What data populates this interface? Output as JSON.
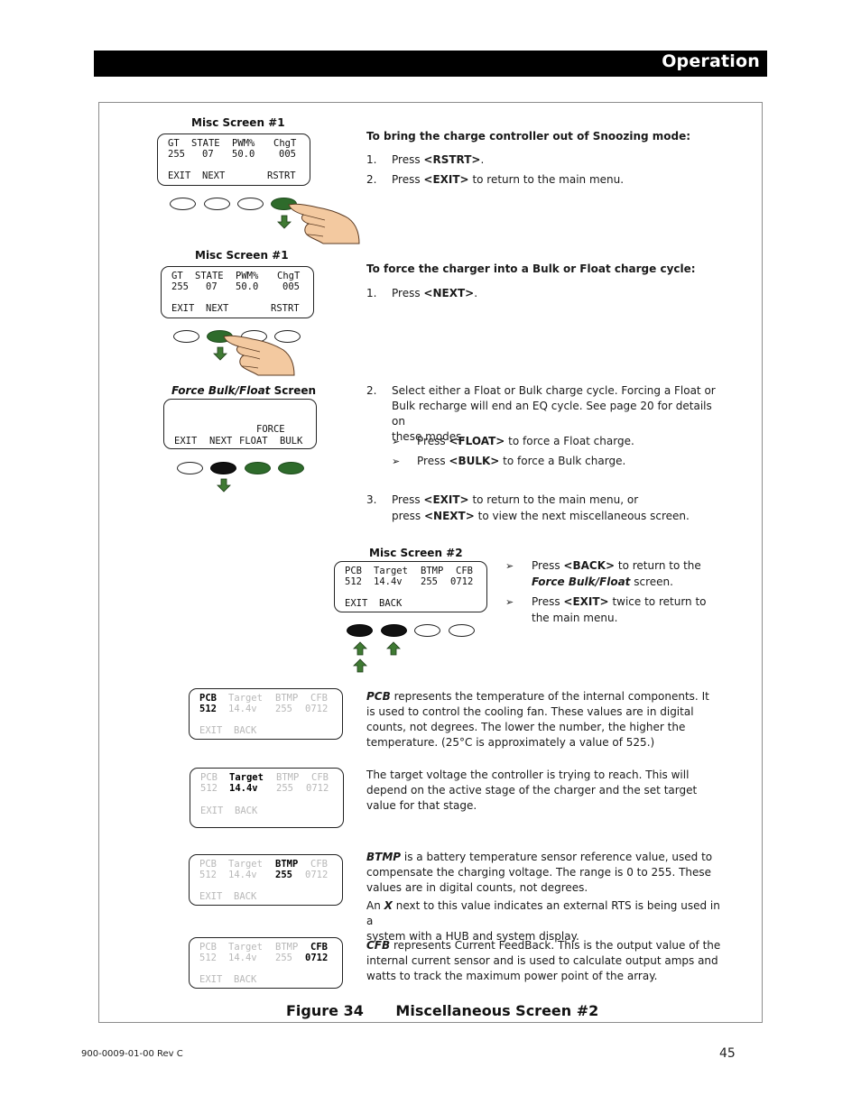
{
  "header": {
    "title": "Operation"
  },
  "screens": {
    "misc1_a": {
      "caption": "Misc Screen #1",
      "headers": [
        "GT",
        "STATE",
        "PWM%",
        "ChgT"
      ],
      "values": [
        "255",
        "07",
        "50.0",
        "005"
      ],
      "softkeys": [
        "EXIT",
        "NEXT",
        "",
        "RSTRT"
      ],
      "buttons": [
        "white",
        "white",
        "white",
        "green"
      ],
      "pressed_button": 4
    },
    "misc1_b": {
      "caption": "Misc Screen #1",
      "headers": [
        "GT",
        "STATE",
        "PWM%",
        "ChgT"
      ],
      "values": [
        "255",
        "07",
        "50.0",
        "005"
      ],
      "softkeys": [
        "EXIT",
        "NEXT",
        "",
        "RSTRT"
      ],
      "buttons": [
        "white",
        "green",
        "white",
        "white"
      ],
      "pressed_button": 2
    },
    "force": {
      "caption_italic": "Force Bulk/Float",
      "caption_rest": " Screen",
      "line1": "FORCE",
      "softkeys": [
        "EXIT",
        "NEXT",
        "FLOAT",
        "BULK"
      ],
      "buttons": [
        "white",
        "black",
        "green",
        "green"
      ]
    },
    "misc2": {
      "caption": "Misc Screen #2",
      "headers": [
        "PCB",
        "Target",
        "BTMP",
        "CFB"
      ],
      "values": [
        "512",
        "14.4v",
        "255",
        "0712"
      ],
      "softkeys": [
        "EXIT",
        "BACK"
      ],
      "buttons": [
        "black",
        "black",
        "white",
        "white"
      ]
    }
  },
  "sections": {
    "snooze": {
      "heading": "To bring the charge controller out of Snoozing mode:",
      "steps": [
        {
          "num": "1.",
          "pre": "Press ",
          "key": "<RSTRT>",
          "post": "."
        },
        {
          "num": "2.",
          "pre": "Press ",
          "key": "<EXIT>",
          "post": " to return to the main menu."
        }
      ]
    },
    "force": {
      "heading": "To force the charger into a Bulk or Float charge cycle:",
      "step1": {
        "num": "1.",
        "pre": "Press ",
        "key": "<NEXT>",
        "post": "."
      },
      "step2": {
        "num": "2.",
        "lines": [
          "Select either a Float or Bulk charge cycle.  Forcing a Float or",
          "Bulk recharge will end an EQ cycle.  See page 20 for details on",
          "these modes."
        ]
      },
      "bullets": [
        {
          "pre": "Press ",
          "key": "<FLOAT>",
          "post": " to force a Float charge."
        },
        {
          "pre": "Press ",
          "key": "<BULK>",
          "post": " to force a Bulk charge."
        }
      ],
      "step3": {
        "num": "3.",
        "line1_pre": "Press ",
        "line1_key": "<EXIT>",
        "line1_post": " to return to the main menu, or",
        "line2_pre": "press ",
        "line2_key": "<NEXT>",
        "line2_post": " to view the next miscellaneous screen."
      }
    },
    "misc2_nav": {
      "bullet1_pre": "Press ",
      "bullet1_key": "<BACK>",
      "bullet1_post": " to return to the",
      "bullet1_line2_italic": "Force Bulk/Float",
      "bullet1_line2_post": " screen.",
      "bullet2_pre": "Press ",
      "bullet2_key": "<EXIT>",
      "bullet2_post": " twice to return to",
      "bullet2_line2": "the main menu."
    },
    "descriptions": {
      "pcb": {
        "term": "PCB",
        "lines": [
          " represents the temperature of the internal components.  It",
          "is used to control the cooling fan.  These values are in digital",
          "counts, not degrees.   The lower the number, the higher the",
          "temperature.  (25°C is approximately a value of 525.)"
        ]
      },
      "target": {
        "lines": [
          "The target voltage the controller is trying to reach.  This will",
          "depend on the active stage of the charger and the set target",
          "value for that stage."
        ]
      },
      "btmp": {
        "term": "BTMP",
        "lines": [
          " is a battery temperature sensor reference value, used to",
          "compensate the charging voltage.  The range is 0 to 255.  These",
          "values are in digital counts, not degrees."
        ],
        "x_pre": "An ",
        "x_term": "X",
        "x_post": " next to this value indicates an external RTS is being used in a",
        "x_line2": "system with a HUB and system display."
      },
      "cfb": {
        "term": "CFB",
        "lines": [
          " represents Current FeedBack.  This is the output value of the",
          "internal current sensor and is used to calculate output amps and",
          "watts to track the maximum power point of the array."
        ]
      }
    }
  },
  "highlight_screens": [
    {
      "highlight": 0
    },
    {
      "highlight": 1
    },
    {
      "highlight": 2
    },
    {
      "highlight": 3
    }
  ],
  "figure": {
    "number": "Figure 34",
    "title": "Miscellaneous Screen #2"
  },
  "footer": {
    "doc_id": "900-0009-01-00 Rev C",
    "page": "45"
  },
  "colors": {
    "button_green": "#2e6b2b",
    "arrow_green": "#3f7a33",
    "hand": "#f3c9a0",
    "dim_text": "#b8b8b8"
  }
}
